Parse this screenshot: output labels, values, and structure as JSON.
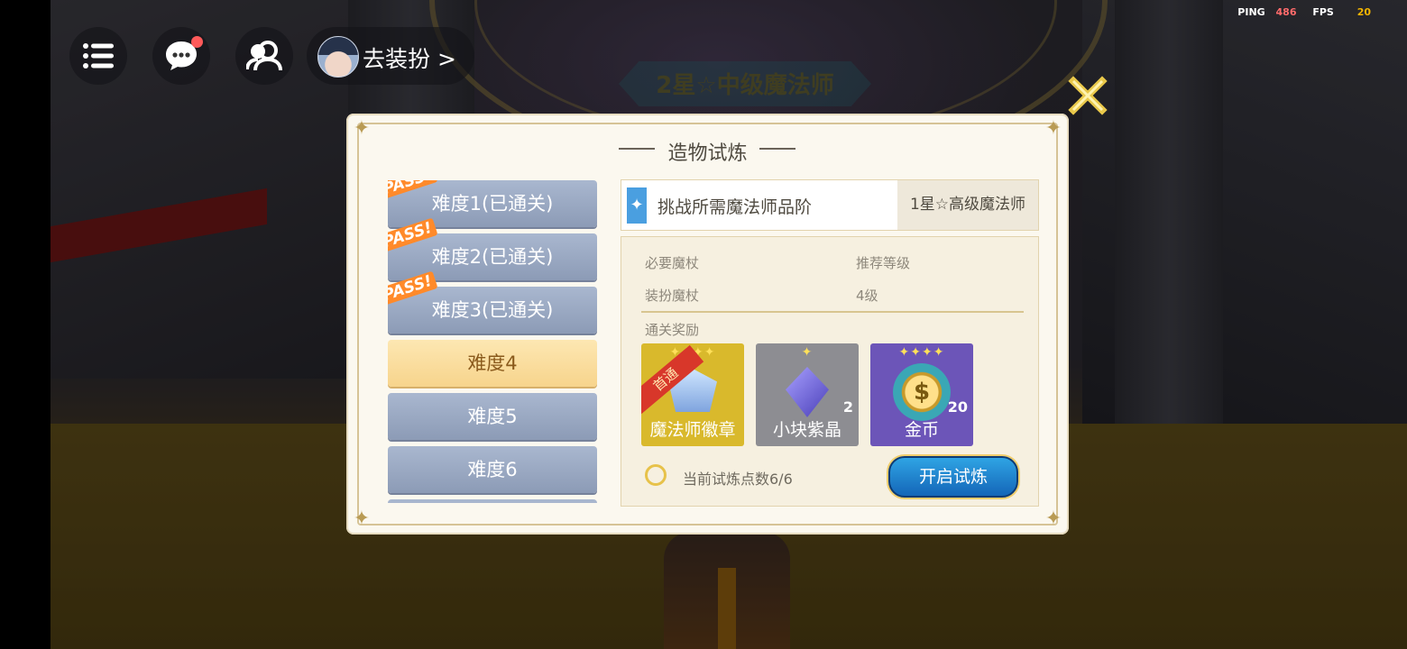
{
  "hud": {
    "dress_up_label": "去装扮 >",
    "ping_label": "PING",
    "ping_value": "486",
    "fps_label": "FPS",
    "fps_value": "20"
  },
  "background": {
    "rank_banner": "2星☆中级魔法师"
  },
  "dialog": {
    "title": "造物试炼",
    "difficulties": [
      {
        "label": "难度1(已通关)",
        "pass": true
      },
      {
        "label": "难度2(已通关)",
        "pass": true
      },
      {
        "label": "难度3(已通关)",
        "pass": true
      },
      {
        "label": "难度4",
        "pass": false,
        "selected": true
      },
      {
        "label": "难度5",
        "pass": false
      },
      {
        "label": "难度6",
        "pass": false
      }
    ],
    "pass_tag": "PASS!",
    "requirement": {
      "label": "挑战所需魔法师品阶",
      "value": "1星☆高级魔法师"
    },
    "info": {
      "wand_label": "必要魔杖",
      "level_label": "推荐等级",
      "wand_value": "装扮魔杖",
      "level_value": "4级",
      "rewards_label": "通关奖励"
    },
    "rewards": [
      {
        "name": "魔法师徽章",
        "stars": "✦✦✦✦",
        "ribbon": "首通",
        "count": "",
        "color": "#d9b92c"
      },
      {
        "name": "小块紫晶",
        "stars": "✦",
        "ribbon": "",
        "count": "2",
        "color": "#8d8d92"
      },
      {
        "name": "金币",
        "stars": "✦✦✦✦",
        "ribbon": "",
        "count": "20",
        "color": "#6c55b8"
      }
    ],
    "trial_points": "当前试炼点数6/6",
    "start_button": "开启试炼"
  }
}
